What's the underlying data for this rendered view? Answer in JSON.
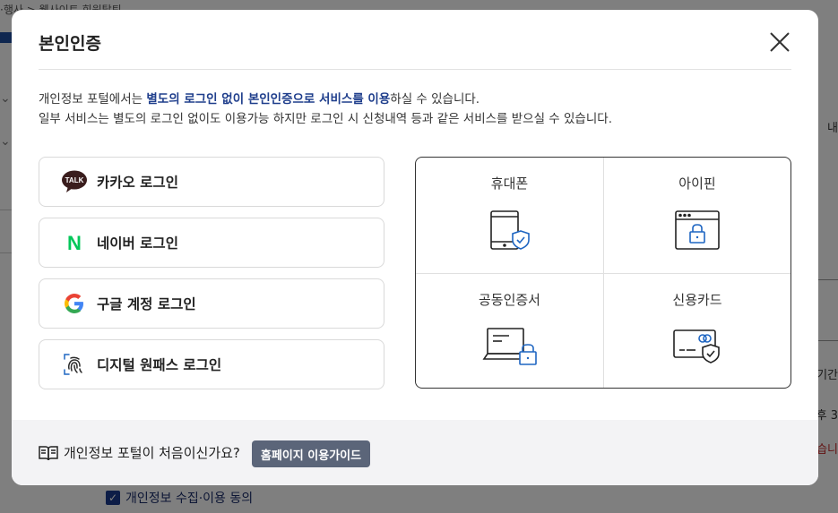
{
  "background": {
    "breadcrumb": "·행사 > 웹사이트 회원탈퇴",
    "right_labels": [
      "내",
      "기간",
      "후 3",
      "습니"
    ],
    "consent_label": "개인정보 수집·이용 동의"
  },
  "modal": {
    "title": "본인인증",
    "description": {
      "line1_prefix": "개인정보 포털에서는 ",
      "line1_highlight": "별도의 로그인 없이 본인인증으로 서비스를 이용",
      "line1_suffix": "하실 수 있습니다.",
      "line2": "일부 서비스는 별도의 로그인 없이도 이용가능 하지만 로그인 시 신청내역 등과 같은 서비스를 받으실 수 있습니다."
    },
    "logins": [
      {
        "label": "카카오 로그인",
        "icon": "kakao-talk-icon",
        "icon_text": "TALK"
      },
      {
        "label": "네이버 로그인",
        "icon": "naver-icon",
        "icon_text": "N"
      },
      {
        "label": "구글 계정 로그인",
        "icon": "google-icon",
        "icon_text": "G"
      },
      {
        "label": "디지털 원패스 로그인",
        "icon": "fingerprint-icon"
      }
    ],
    "certs": [
      {
        "label": "휴대폰",
        "icon": "mobile-shield-icon"
      },
      {
        "label": "아이핀",
        "icon": "browser-lock-icon"
      },
      {
        "label": "공동인증서",
        "icon": "laptop-lock-icon"
      },
      {
        "label": "신용카드",
        "icon": "card-shield-icon"
      }
    ],
    "footer": {
      "question": "개인정보 포털이 처음이신가요?",
      "guide_button": "홈페이지 이용가이드"
    }
  },
  "colors": {
    "accent": "#1f3e8c",
    "kakao_bubble": "#3a1d1d",
    "naver_green": "#03c75a",
    "icon_blue": "#1f66c2",
    "guide_button_bg": "#5b6579"
  }
}
